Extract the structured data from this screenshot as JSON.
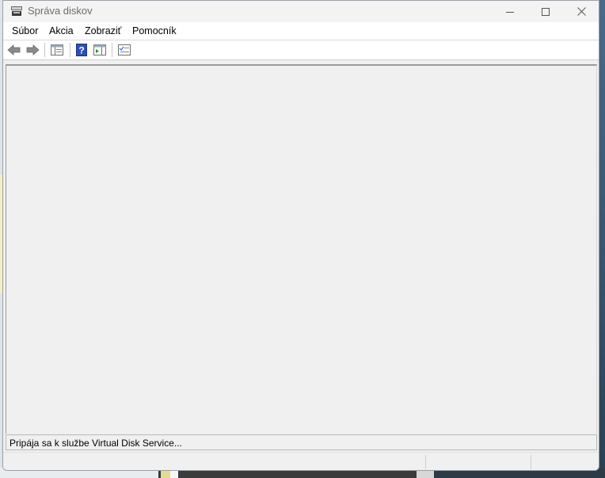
{
  "window": {
    "title": "Správa diskov",
    "controls": {
      "minimize": "minimize",
      "maximize": "maximize",
      "close": "close"
    }
  },
  "menu": {
    "items": [
      {
        "label": "Súbor"
      },
      {
        "label": "Akcia"
      },
      {
        "label": "Zobraziť"
      },
      {
        "label": "Pomocník"
      }
    ]
  },
  "toolbar": {
    "buttons": [
      {
        "icon": "back-arrow-icon"
      },
      {
        "icon": "forward-arrow-icon"
      },
      {
        "icon": "show-hide-console-tree-icon"
      },
      {
        "icon": "help-icon"
      },
      {
        "icon": "show-hide-action-pane-icon"
      },
      {
        "icon": "properties-icon"
      }
    ]
  },
  "status": {
    "message": "Pripája sa k službe Virtual Disk Service..."
  },
  "colors": {
    "window_bg": "#f0f0f0",
    "menubar_bg": "#ffffff",
    "help_blue": "#2b4fb8"
  }
}
